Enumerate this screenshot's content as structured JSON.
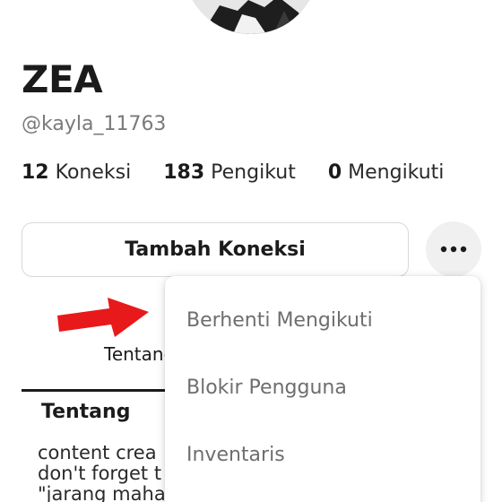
{
  "profile": {
    "display_name": "ZEA",
    "username": "@kayla_11763"
  },
  "stats": [
    {
      "value": "12",
      "label": "Koneksi"
    },
    {
      "value": "183",
      "label": "Pengikut"
    },
    {
      "value": "0",
      "label": "Mengikuti"
    }
  ],
  "actions": {
    "connect_label": "Tambah Koneksi",
    "more_icon": "more-horizontal-icon"
  },
  "tabs": {
    "about_label": "Tentang"
  },
  "about": {
    "title": "Tentang",
    "bio_lines": [
      "content crea",
      "don't forget t",
      "\"jarang maha"
    ]
  },
  "menu": {
    "items": [
      "Berhenti Mengikuti",
      "Blokir Pengguna",
      "Inventaris"
    ]
  },
  "annotation": {
    "arrow_color": "#e8191b"
  }
}
